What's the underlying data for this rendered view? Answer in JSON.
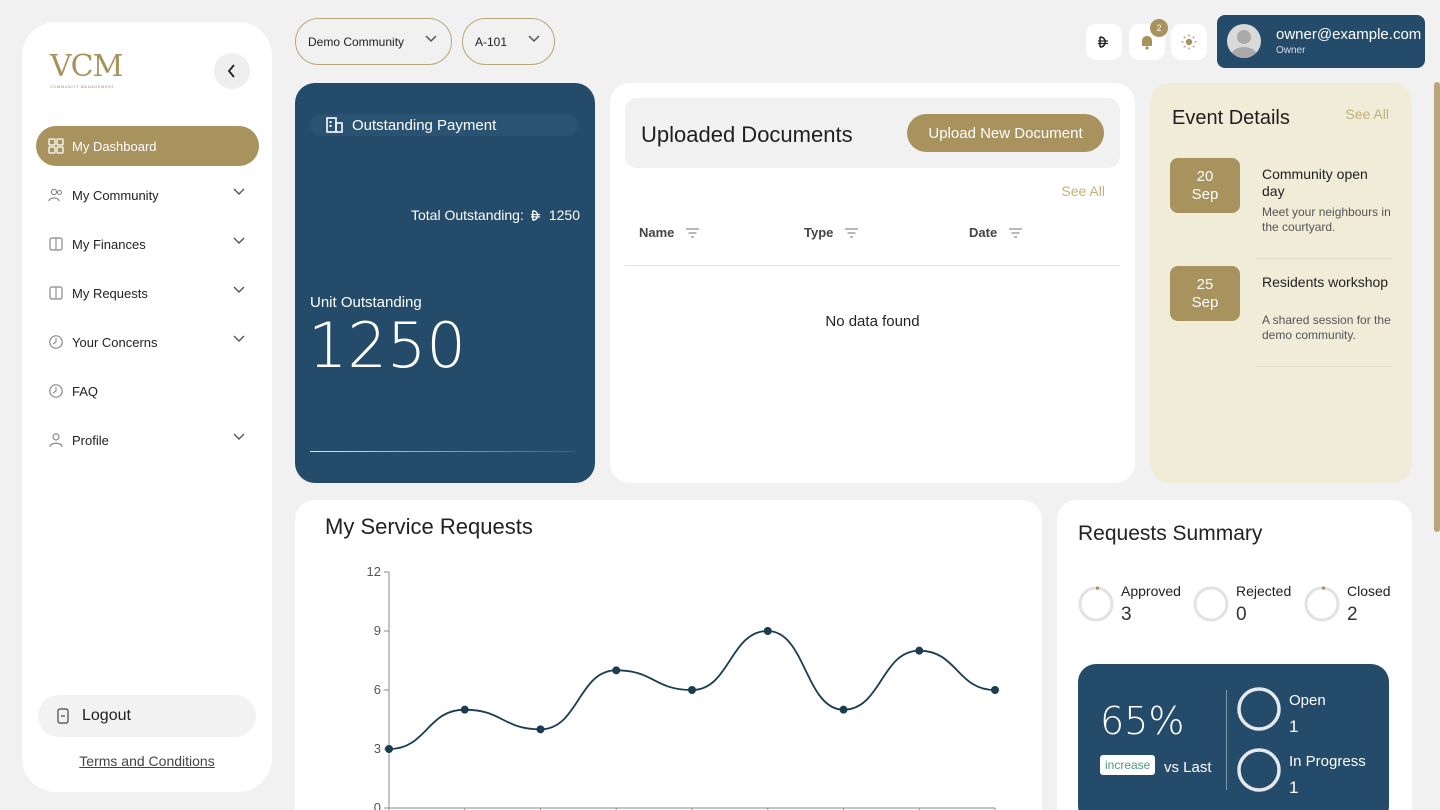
{
  "sidebar": {
    "logo_main": "VCM",
    "logo_sub": "COMMUNITY MANAGEMENT",
    "items": [
      {
        "label": "My Dashboard",
        "icon": "dashboard-icon"
      },
      {
        "label": "My Community",
        "icon": "people-icon"
      },
      {
        "label": "My Finances",
        "icon": "wallet-icon"
      },
      {
        "label": "My Requests",
        "icon": "wallet-icon"
      },
      {
        "label": "Your Concerns",
        "icon": "clock-icon"
      },
      {
        "label": "FAQ",
        "icon": "clock-icon"
      },
      {
        "label": "Profile",
        "icon": "user-icon"
      }
    ],
    "logout_label": "Logout",
    "terms_label": "Terms and Conditions"
  },
  "topbar": {
    "community_select": "Demo Community",
    "unit_select": "A-101",
    "notification_count": "2",
    "user_email": "owner@example.com",
    "user_role": "Owner"
  },
  "outstanding": {
    "title": "Outstanding Payment",
    "total_label": "Total Outstanding:",
    "total_value": "1250",
    "unit_label": "Unit Outstanding",
    "unit_value": "1250"
  },
  "documents": {
    "title": "Uploaded Documents",
    "upload_label": "Upload New Document",
    "see_all": "See All",
    "columns": [
      "Name",
      "Type",
      "Date"
    ],
    "empty_text": "No data found"
  },
  "events": {
    "title": "Event Details",
    "see_all": "See All",
    "items": [
      {
        "day": "20",
        "month": "Sep",
        "title": "Community open day",
        "desc": "Meet your neighbours in the courtyard."
      },
      {
        "day": "25",
        "month": "Sep",
        "title": "Residents workshop",
        "desc": "A shared session for the demo community."
      }
    ]
  },
  "service_requests": {
    "title": "My Service Requests"
  },
  "chart_data": {
    "type": "line",
    "title": "My Service Requests",
    "x": [
      1,
      2,
      3,
      4,
      5,
      6,
      7,
      8,
      9
    ],
    "series": [
      {
        "values": [
          3,
          5,
          4,
          7,
          6,
          9,
          5,
          8,
          6
        ]
      }
    ],
    "yticks": [
      "0",
      "3",
      "6",
      "9",
      "12"
    ],
    "ylim": [
      0,
      12
    ],
    "line_color": "#1b3d52",
    "grid": false
  },
  "summary": {
    "title": "Requests Summary",
    "stats": [
      {
        "label": "Approved",
        "value": "3"
      },
      {
        "label": "Rejected",
        "value": "0"
      },
      {
        "label": "Closed",
        "value": "2"
      }
    ],
    "percent": "65%",
    "increase_label": "increase",
    "vs_last": "vs Last",
    "open_label": "Open",
    "open_value": "1",
    "inprogress_label": "In Progress",
    "inprogress_value": "1"
  },
  "colors": {
    "accent": "#a8925e",
    "navy": "#244b6a",
    "cream": "#f0ecd8"
  }
}
